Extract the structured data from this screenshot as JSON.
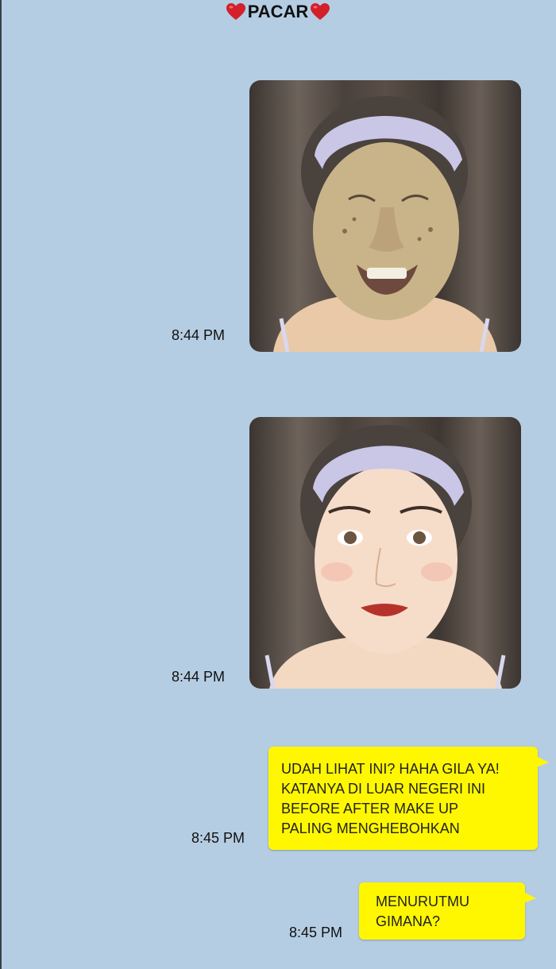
{
  "header": {
    "title": "PACAR",
    "left_icon": "heart-icon",
    "right_icon": "heart-icon",
    "heart_color": "#d4202a"
  },
  "colors": {
    "background": "#b5cde3",
    "bubble": "#fff700"
  },
  "messages": [
    {
      "type": "image",
      "time": "8:44 PM",
      "content": "photo"
    },
    {
      "type": "image",
      "time": "8:44 PM",
      "content": "photo"
    },
    {
      "type": "text",
      "time": "8:45 PM",
      "lines": [
        "UDAH LIHAT INI? HAHA GILA YA!",
        "KATANYA DI LUAR NEGERI INI",
        "BEFORE AFTER MAKE UP",
        "PALING MENGHEBOHKAN"
      ]
    },
    {
      "type": "text",
      "time": "8:45 PM",
      "lines": [
        "MENURUTMU",
        "GIMANA?"
      ]
    }
  ]
}
